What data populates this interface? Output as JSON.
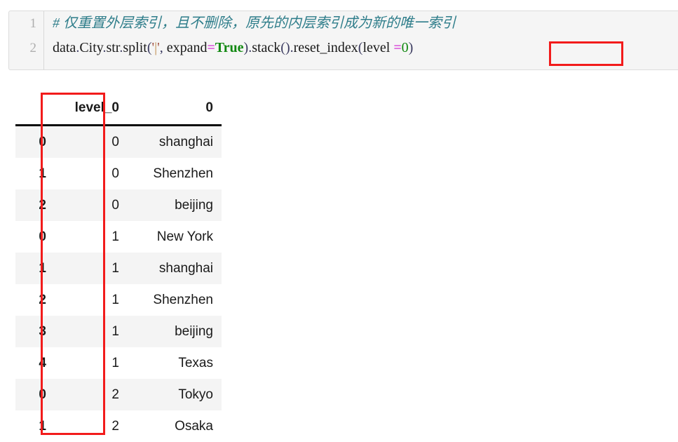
{
  "code_cell": {
    "line_numbers": [
      "1",
      "2"
    ],
    "line1_comment": "# 仅重置外层索引，且不删除，原先的内层索引成为新的唯一索引",
    "line2": {
      "obj": "data",
      "dot1": ".",
      "attr_city": "City",
      "dot2": ".",
      "attr_str": "str",
      "dot3": ".",
      "method_split": "split",
      "paren_open": "(",
      "quote_open": "'",
      "pipe": "|",
      "quote_close": "'",
      "comma": ", ",
      "kwarg_expand": "expand",
      "eq1": "=",
      "true_literal": "True",
      "paren_close": ")",
      "dot4": ".",
      "method_stack": "stack",
      "stack_parens": "()",
      "dot5": ".",
      "method_reset": "reset_index",
      "paren_open2": "(",
      "kwarg_level": "level ",
      "eq2": "=",
      "zero": "0",
      "paren_close2": ")"
    },
    "highlight_color": "#f21b1b",
    "background": "#f5f5f5",
    "comment_color": "#2e7d8a",
    "keyword_color": "#118811",
    "operator_color": "#cc00cc",
    "string_color": "#9c4a3c"
  },
  "dataframe": {
    "headers": [
      "",
      "level_0",
      "0"
    ],
    "rows": [
      {
        "index": "0",
        "level_0": "0",
        "value": "shanghai"
      },
      {
        "index": "1",
        "level_0": "0",
        "value": "Shenzhen"
      },
      {
        "index": "2",
        "level_0": "0",
        "value": "beijing"
      },
      {
        "index": "0",
        "level_0": "1",
        "value": "New York"
      },
      {
        "index": "1",
        "level_0": "1",
        "value": "shanghai"
      },
      {
        "index": "2",
        "level_0": "1",
        "value": "Shenzhen"
      },
      {
        "index": "3",
        "level_0": "1",
        "value": "beijing"
      },
      {
        "index": "4",
        "level_0": "1",
        "value": "Texas"
      },
      {
        "index": "0",
        "level_0": "2",
        "value": "Tokyo"
      },
      {
        "index": "1",
        "level_0": "2",
        "value": "Osaka"
      }
    ],
    "stripe_color": "#f4f4f4",
    "highlight_color": "#f21b1b"
  }
}
